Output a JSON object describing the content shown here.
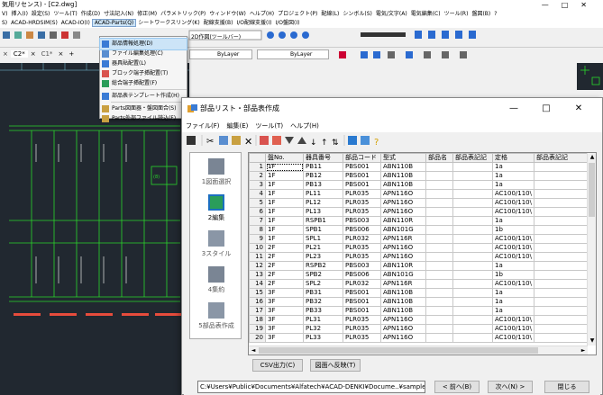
{
  "cad": {
    "title": "気用リセンス) - [C2.dwg]",
    "window_buttons": [
      "—",
      "□",
      "✕"
    ],
    "menubar": [
      "V)",
      "挿入(I)",
      "設定(S)",
      "ツール(T)",
      "作成(D)",
      "寸法記入(N)",
      "修正(M)",
      "パラメトリック(P)",
      "ウィンドウ(W)",
      "ヘルプ(H)",
      "プロジェクト(P)",
      "配線(L)",
      "シンボル(S)",
      "電気/文字(A)",
      "電気編集(C)",
      "ツール(R)",
      "盤図(B)",
      "?"
    ],
    "menubar_highlight_index": -1,
    "tabs": [
      "S)",
      "ACAD-HRDSIM(S)",
      "ACAD-IO(I)",
      "ACAD-Parts(Q)",
      "シートワークスリング(K)",
      "配線支援(B)",
      "I/O配線支援(I)",
      "I/O盤図(I)"
    ],
    "tabs_active_index": 3,
    "toolbar_combo1": "2D作図(ツールバー)",
    "toolbar_combo2": "ByLayer",
    "toolbar_combo3": "ByLayer",
    "cmd_tab": "C2*",
    "cmd_tab2": "C1*"
  },
  "dropdown": {
    "items": [
      {
        "label": "部品情報処理(D)",
        "selected": true
      },
      {
        "label": "ファイル編集処理(C)",
        "selected": false
      },
      {
        "label": "器具貼配置(L)",
        "selected": false
      },
      {
        "label": "ブロック端子挿配置(T)",
        "selected": false
      },
      {
        "label": "総合端子挿配置(F)",
        "selected": false
      },
      {
        "label": "部品表テンプレート作成(H)",
        "selected": false
      },
      {
        "label": "Parts図面器・盤図面合(S)",
        "selected": false
      },
      {
        "label": "Parts外部ファイル読込(F)",
        "selected": false
      }
    ]
  },
  "dialog": {
    "title": "部品リスト・部品表作成",
    "window_buttons": [
      "—",
      "□",
      "✕"
    ],
    "menu": [
      "ファイル(F)",
      "編集(E)",
      "ツール(T)",
      "ヘルプ(H)"
    ],
    "nav": [
      {
        "label": "1図面選択",
        "icon": "document-stack-icon",
        "active": false
      },
      {
        "label": "2編集",
        "icon": "table-edit-icon",
        "active": true
      },
      {
        "label": "3スタイル",
        "icon": "style-icon",
        "active": false
      },
      {
        "label": "4集約",
        "icon": "pencil-icon",
        "active": false
      },
      {
        "label": "5部品表作成",
        "icon": "create-table-icon",
        "active": false
      }
    ],
    "columns": [
      "",
      "盤No.",
      "器具番号",
      "部品コード",
      "型式",
      "部品名",
      "部品表記記",
      "定格",
      "部品表記記"
    ],
    "rows": [
      [
        "1",
        "1F",
        "PB11",
        "PBS001",
        "ABN110B",
        "",
        "",
        "1a",
        ""
      ],
      [
        "2",
        "1F",
        "PB12",
        "PBS001",
        "ABN110B",
        "",
        "",
        "1a",
        ""
      ],
      [
        "3",
        "1F",
        "PB13",
        "PBS001",
        "ABN110B",
        "",
        "",
        "1a",
        ""
      ],
      [
        "4",
        "1F",
        "PL11",
        "PLR035",
        "APN116O",
        "",
        "",
        "AC100/110\\",
        ""
      ],
      [
        "5",
        "1F",
        "PL12",
        "PLR035",
        "APN116O",
        "",
        "",
        "AC100/110\\",
        ""
      ],
      [
        "6",
        "1F",
        "PL13",
        "PLR035",
        "APN116O",
        "",
        "",
        "AC100/110\\",
        ""
      ],
      [
        "7",
        "1F",
        "RSPB1",
        "PBS003",
        "ABN110R",
        "",
        "",
        "1a",
        ""
      ],
      [
        "8",
        "1F",
        "SPB1",
        "PBS006",
        "ABN101G",
        "",
        "",
        "1b",
        ""
      ],
      [
        "9",
        "1F",
        "SPL1",
        "PLR032",
        "APN116R",
        "",
        "",
        "AC100/110\\",
        ""
      ],
      [
        "10",
        "2F",
        "PL21",
        "PLR035",
        "APN116O",
        "",
        "",
        "AC100/110\\",
        ""
      ],
      [
        "11",
        "2F",
        "PL23",
        "PLR035",
        "APN116O",
        "",
        "",
        "AC100/110\\",
        ""
      ],
      [
        "12",
        "2F",
        "RSPB2",
        "PBS003",
        "ABN110R",
        "",
        "",
        "1a",
        ""
      ],
      [
        "13",
        "2F",
        "SPB2",
        "PBS006",
        "ABN101G",
        "",
        "",
        "1b",
        ""
      ],
      [
        "14",
        "2F",
        "SPL2",
        "PLR032",
        "APN116R",
        "",
        "",
        "AC100/110\\",
        ""
      ],
      [
        "15",
        "3F",
        "PB31",
        "PBS001",
        "ABN110B",
        "",
        "",
        "1a",
        ""
      ],
      [
        "16",
        "3F",
        "PB32",
        "PBS001",
        "ABN110B",
        "",
        "",
        "1a",
        ""
      ],
      [
        "17",
        "3F",
        "PB33",
        "PBS001",
        "ABN110B",
        "",
        "",
        "1a",
        ""
      ],
      [
        "18",
        "3F",
        "PL31",
        "PLR035",
        "APN116O",
        "",
        "",
        "AC100/110\\",
        ""
      ],
      [
        "19",
        "3F",
        "PL32",
        "PLR035",
        "APN116O",
        "",
        "",
        "AC100/110\\",
        ""
      ],
      [
        "20",
        "3F",
        "PL33",
        "PLR035",
        "APN116O",
        "",
        "",
        "AC100/110\\",
        ""
      ]
    ],
    "csv_button": "CSV出力(C)",
    "reflect_button": "図面へ反映(T)",
    "path": "C:¥Users¥Public¥Documents¥Alfatech¥ACAD-DENKI¥Docume..¥sample",
    "prev_button": "< 前へ(B)",
    "next_button": "次へ(N) >",
    "close_button": "閉じる"
  },
  "colors": {
    "cad_bg": "#212830",
    "wire_green": "#2bd62b",
    "wire_white": "#e8e8e8",
    "selection": "#cce4f7"
  }
}
